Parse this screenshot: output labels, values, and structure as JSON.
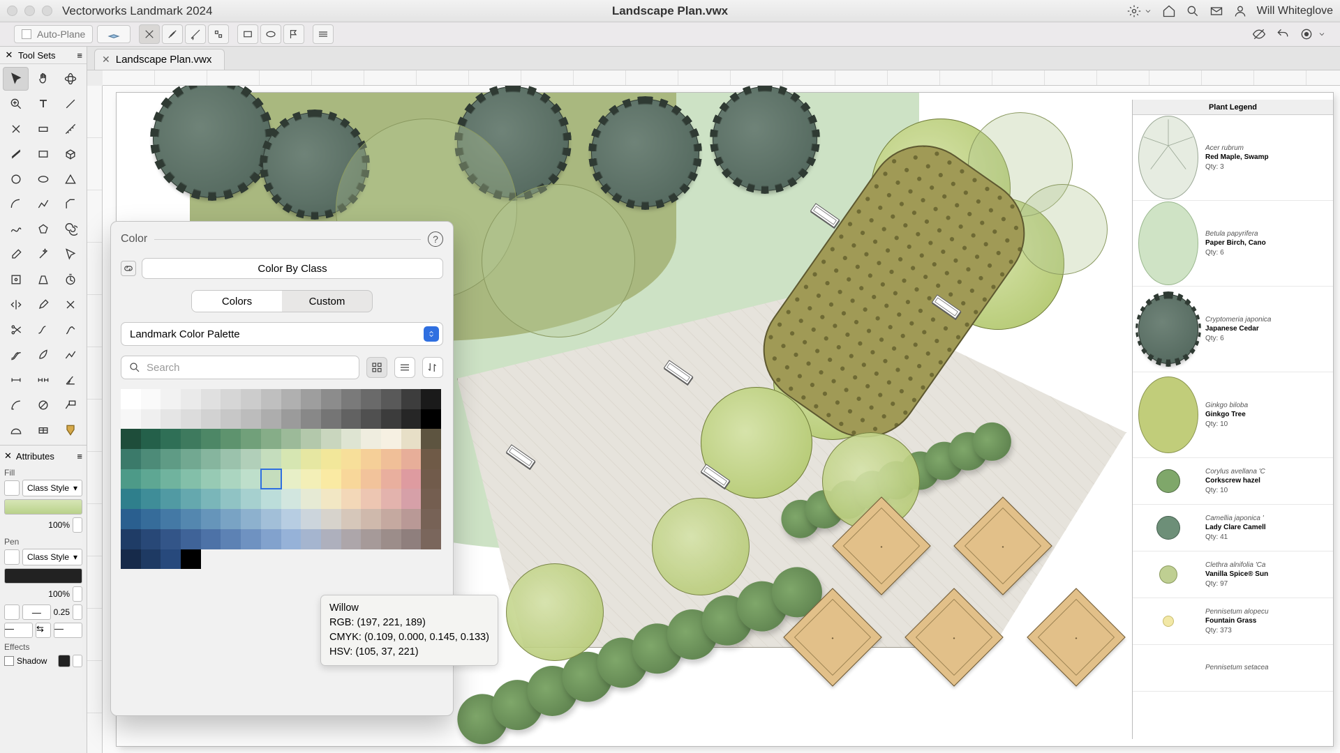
{
  "titlebar": {
    "app_name": "Vectorworks Landmark 2024",
    "doc_title": "Landscape Plan.vwx",
    "user_name": "Will Whiteglove"
  },
  "modebar": {
    "plane_label": "Auto-Plane"
  },
  "tab": {
    "label": "Landscape Plan.vwx"
  },
  "toolsets": {
    "title": "Tool Sets"
  },
  "attributes": {
    "title": "Attributes",
    "fill_label": "Fill",
    "fill_style": "Class Style",
    "fill_opacity": "100%",
    "pen_label": "Pen",
    "pen_style": "Class Style",
    "pen_opacity": "100%",
    "line_weight": "0.25",
    "effects_label": "Effects",
    "shadow_label": "Shadow"
  },
  "color_popover": {
    "header": "Color",
    "color_by_class": "Color By Class",
    "tab_colors": "Colors",
    "tab_custom": "Custom",
    "palette_name": "Landmark Color Palette",
    "search_placeholder": "Search"
  },
  "tooltip": {
    "name": "Willow",
    "rgb": "RGB: (197, 221, 189)",
    "cmyk": "CMYK: (0.109, 0.000, 0.145, 0.133)",
    "hsv": "HSV: (105, 37, 221)"
  },
  "legend": {
    "title": "Plant Legend",
    "rows": [
      {
        "latin": "Acer rubrum",
        "name": "Red Maple, Swamp",
        "qty": "Qty:  3"
      },
      {
        "latin": "Betula papyrifera",
        "name": "Paper Birch, Cano",
        "qty": "Qty:  6"
      },
      {
        "latin": "Cryptomeria japonica",
        "name": "Japanese Cedar",
        "qty": "Qty:  6"
      },
      {
        "latin": "Ginkgo biloba",
        "name": "Ginkgo Tree",
        "qty": "Qty:  10"
      },
      {
        "latin": "Corylus avellana 'C",
        "name": "Corkscrew hazel",
        "qty": "Qty:  10"
      },
      {
        "latin": "Camellia japonica '",
        "name": "Lady Clare Camell",
        "qty": "Qty:  41"
      },
      {
        "latin": "Clethra alnifolia 'Ca",
        "name": "Vanilla Spice® Sun",
        "qty": "Qty:  97"
      },
      {
        "latin": "Pennisetum alopecu",
        "name": "Fountain Grass",
        "qty": "Qty:  373"
      },
      {
        "latin": "Pennisetum setacea",
        "name": "",
        "qty": ""
      }
    ]
  },
  "palette_colors": {
    "grays": [
      "#ffffff",
      "#fafafa",
      "#f2f2f2",
      "#eaeaea",
      "#e0e0e0",
      "#d6d6d6",
      "#cccccc",
      "#bfbfbf",
      "#b0b0b0",
      "#9e9e9e",
      "#8c8c8c",
      "#7a7a7a",
      "#6a6a6a",
      "#595959",
      "#3d3d3d",
      "#1a1a1a"
    ],
    "grays2": [
      "#f7f7f7",
      "#efefef",
      "#e5e5e5",
      "#dcdcdc",
      "#d2d2d2",
      "#c7c7c7",
      "#bcbcbc",
      "#adadad",
      "#9b9b9b",
      "#888888",
      "#757575",
      "#626262",
      "#505050",
      "#3c3c3c",
      "#262626",
      "#000000"
    ],
    "greens1": [
      "#1e4d3a",
      "#24604a",
      "#2f6f56",
      "#3e7a5e",
      "#4d8766",
      "#5e936e",
      "#71a07a",
      "#86ad88",
      "#9cba99",
      "#b3c8ab",
      "#c9d6be",
      "#dee4d2",
      "#efeddf",
      "#f6f0e2",
      "#e7dfc7",
      "#5d5440"
    ],
    "greens2": [
      "#3b7a6a",
      "#4d8b78",
      "#5f9b85",
      "#72a891",
      "#86b59e",
      "#9bc2ac",
      "#b1cfb9",
      "#c5ddbd",
      "#d6e6b2",
      "#e6e7a2",
      "#f2e79a",
      "#f7df9a",
      "#f5cf98",
      "#f0bf98",
      "#e7ae99",
      "#6f5a47"
    ],
    "greens3": [
      "#4d9a88",
      "#5ea793",
      "#70b39e",
      "#83bfa9",
      "#97cab4",
      "#abd5c0",
      "#bedfcb",
      "#d2e9d7",
      "#e7efc7",
      "#f3efb7",
      "#faeaa3",
      "#f8d79a",
      "#f2c39b",
      "#e9af9e",
      "#de9ba0",
      "#715b4b"
    ],
    "aqua": [
      "#2f7f8c",
      "#3f8d98",
      "#519aa3",
      "#65a8ae",
      "#7ab6b9",
      "#90c3c4",
      "#a6d0cf",
      "#bcddda",
      "#d2e6df",
      "#e6ead4",
      "#f2e7c4",
      "#f3d8b8",
      "#edc6b2",
      "#e3b3ad",
      "#d6a0a8",
      "#745e50"
    ],
    "blues": [
      "#2a5f8f",
      "#366c9a",
      "#4479a5",
      "#5487af",
      "#6695ba",
      "#79a3c4",
      "#8db1ce",
      "#a2bfd8",
      "#b7cde2",
      "#ccd5dc",
      "#d7d3cc",
      "#d6c7ba",
      "#cfb9ac",
      "#c5a9a0",
      "#b99996",
      "#776256"
    ],
    "navy": [
      "#1f3c66",
      "#284877",
      "#335588",
      "#3f6398",
      "#4d72a7",
      "#5d82b4",
      "#6f92c1",
      "#82a2cd",
      "#96b2d8",
      "#a5b5cf",
      "#aeb0bd",
      "#ada6aa",
      "#a69a99",
      "#9c8d8a",
      "#8f7f7d",
      "#7a665c"
    ],
    "tail": [
      "#162a4a",
      "#1e3a63",
      "#27497c",
      "#000000"
    ]
  }
}
